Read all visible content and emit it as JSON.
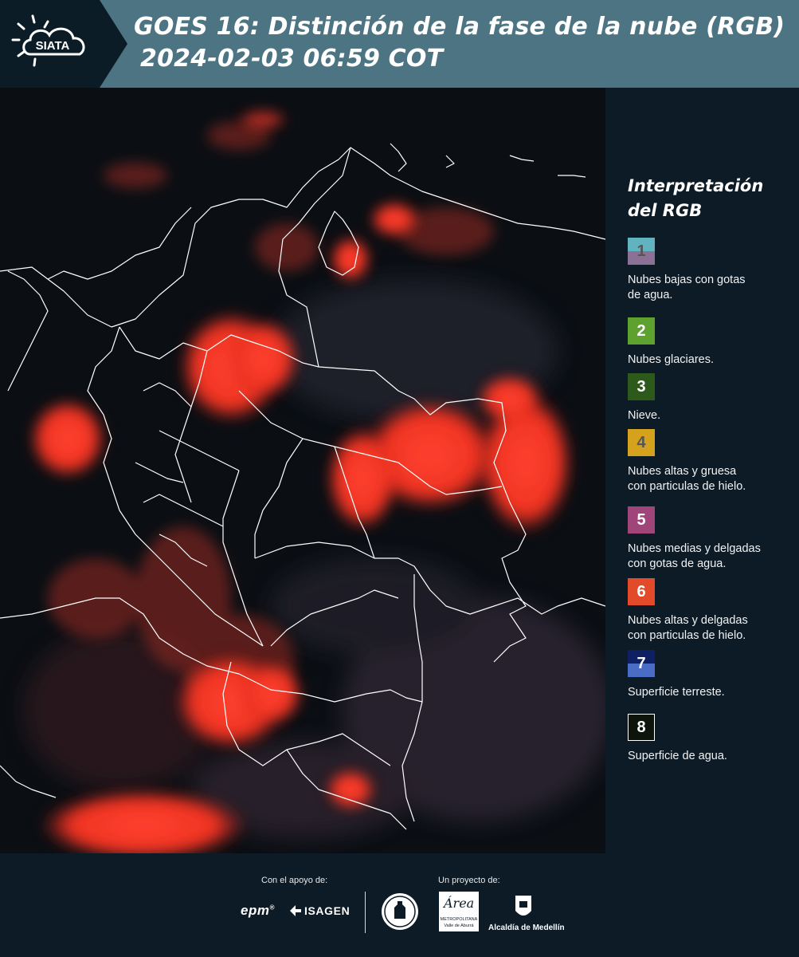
{
  "header": {
    "logo_text": "SIATA",
    "title_line1": "GOES 16: Distinción de la fase de la nube (RGB)",
    "title_line2": "2024-02-03 06:59 COT"
  },
  "legend": {
    "title_line1": "Interpretación",
    "title_line2": "del RGB",
    "items": [
      {
        "number": "1",
        "label_line1": "Nubes bajas con gotas",
        "label_line2": "de agua.",
        "color_top": "#62b3c0",
        "color_bottom": "#8b7196",
        "number_color": "#555555"
      },
      {
        "number": "2",
        "label_line1": "Nubes glaciares.",
        "label_line2": "",
        "color_top": "#5ea12f",
        "color_bottom": "#5ea12f",
        "number_color": "#ffffff"
      },
      {
        "number": "3",
        "label_line1": "Nieve.",
        "label_line2": "",
        "color_top": "#2d5a1a",
        "color_bottom": "#2d5a1a",
        "number_color": "#ffffff"
      },
      {
        "number": "4",
        "label_line1": "Nubes altas y gruesa",
        "label_line2": "con particulas de hielo.",
        "color_top": "#d4a21c",
        "color_bottom": "#d4a21c",
        "number_color": "#555555"
      },
      {
        "number": "5",
        "label_line1": "Nubes medias y delgadas",
        "label_line2": "con gotas de agua.",
        "color_top": "#a0457a",
        "color_bottom": "#a0457a",
        "number_color": "#ffffff"
      },
      {
        "number": "6",
        "label_line1": "Nubes altas y delgadas",
        "label_line2": "con particulas de hielo.",
        "color_top": "#e24a2a",
        "color_bottom": "#e24a2a",
        "number_color": "#ffffff"
      },
      {
        "number": "7",
        "label_line1": "Superficie terreste.",
        "label_line2": "",
        "color_top": "#0f1f63",
        "color_bottom": "#4a6cc4",
        "number_color": "#ffffff"
      },
      {
        "number": "8",
        "label_line1": "Superficie de agua.",
        "label_line2": "",
        "color_top": "#0c140c",
        "color_bottom": "#0c140c",
        "number_color": "#ffffff"
      }
    ]
  },
  "footer": {
    "support_label": "Con el apoyo de:",
    "project_label": "Un proyecto de:",
    "sponsor1": "epm",
    "sponsor2": "ISAGEN",
    "area_logo": "Área",
    "area_sub1": "METROPOLITANA",
    "area_sub2": "Valle de Aburrá",
    "alcaldia": "Alcaldía de Medellín"
  }
}
